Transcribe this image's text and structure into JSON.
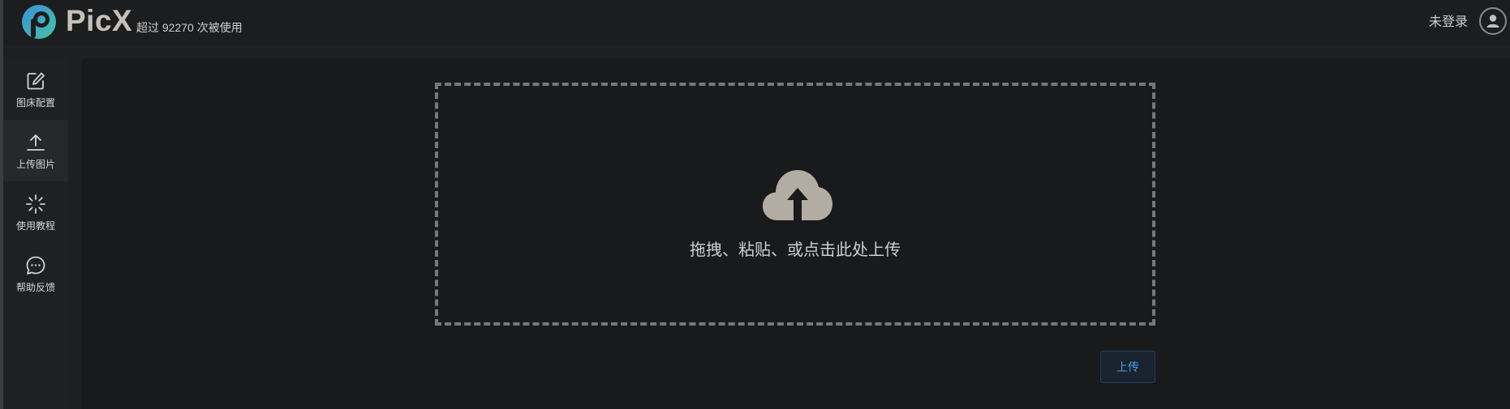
{
  "app": {
    "name": "PicX",
    "usage_text": "超过 92270 次被使用"
  },
  "header": {
    "login_text": "未登录"
  },
  "sidebar": {
    "items": [
      {
        "label": "图床配置",
        "icon": "edit-icon",
        "active": false
      },
      {
        "label": "上传图片",
        "icon": "upload-icon",
        "active": true
      },
      {
        "label": "使用教程",
        "icon": "loader-icon",
        "active": false
      },
      {
        "label": "帮助反馈",
        "icon": "chat-icon",
        "active": false
      }
    ]
  },
  "main": {
    "dropzone_text": "拖拽、粘贴、或点击此处上传",
    "upload_button": "上传"
  },
  "colors": {
    "accent": "#4d9be6",
    "background": "#191a1c",
    "dashed_border": "#77787a"
  }
}
